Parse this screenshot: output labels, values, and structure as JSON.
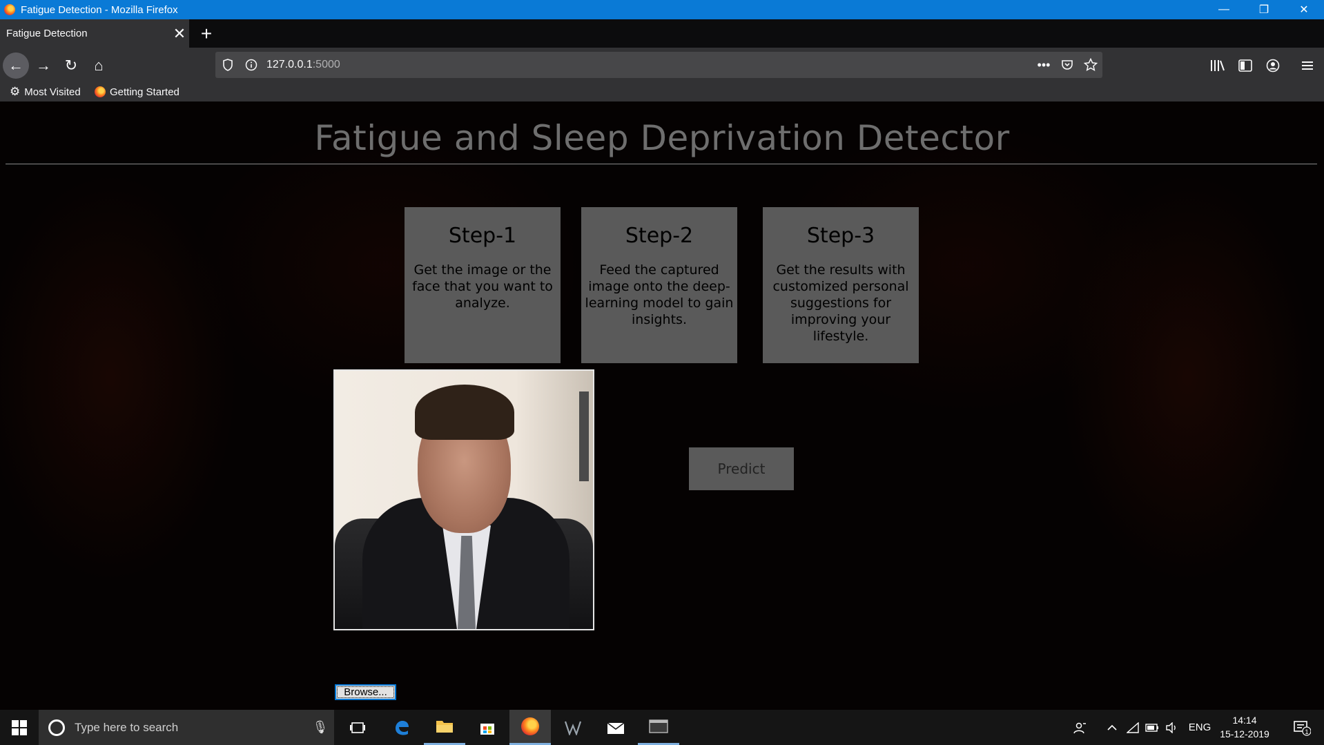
{
  "window": {
    "title": "Fatigue Detection - Mozilla Firefox",
    "controls": {
      "minimize": "—",
      "restore": "❐",
      "close": "✕"
    }
  },
  "tabs": [
    {
      "label": "Fatigue Detection",
      "close": "✕"
    }
  ],
  "new_tab": "+",
  "nav": {
    "back": "←",
    "forward": "→",
    "reload": "↻",
    "home": "⌂",
    "url_host": "127.0.0.1",
    "url_port": ":5000",
    "page_actions": "•••"
  },
  "bookmarks": [
    {
      "label": "Most Visited",
      "icon": "gear-icon"
    },
    {
      "label": "Getting Started",
      "icon": "firefox-icon"
    }
  ],
  "page": {
    "title": "Fatigue and Sleep Deprivation Detector",
    "steps": [
      {
        "title": "Step-1",
        "text": "Get the image or the face that you want to analyze."
      },
      {
        "title": "Step-2",
        "text": "Feed the captured image onto the deep-learning model to gain insights."
      },
      {
        "title": "Step-3",
        "text": "Get the results with customized personal suggestions for improving your lifestyle."
      }
    ],
    "predict_label": "Predict",
    "browse_label": "Browse..."
  },
  "taskbar": {
    "search_placeholder": "Type here to search",
    "language": "ENG",
    "time": "14:14",
    "date": "15-12-2019",
    "notification_count": "1"
  },
  "colors": {
    "titlebar": "#0a7ad6",
    "step_box": "#5a5a5a",
    "page_title": "#6e6e6e"
  }
}
